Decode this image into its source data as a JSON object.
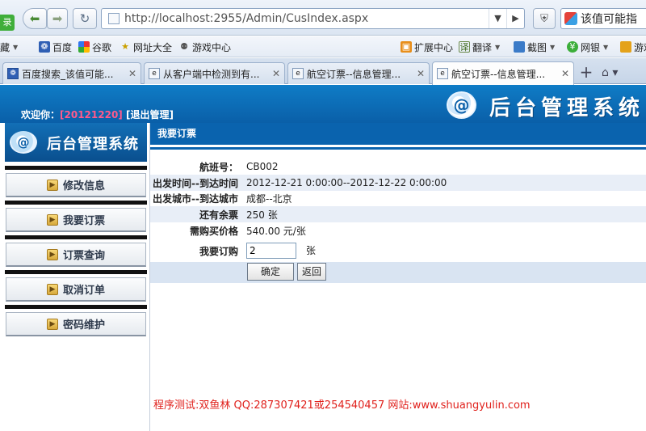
{
  "browser": {
    "url": "http://localhost:2955/Admin/CusIndex.aspx",
    "search_text": "该值可能指",
    "side_tab_text": "录",
    "bookmarks": [
      {
        "label": "藏"
      },
      {
        "label": "百度"
      },
      {
        "label": "谷歌"
      },
      {
        "label": "网址大全"
      },
      {
        "label": "游戏中心"
      },
      {
        "label": "扩展中心"
      },
      {
        "label": "翻译"
      },
      {
        "label": "截图"
      },
      {
        "label": "网银"
      },
      {
        "label": "游戏"
      }
    ],
    "tabs": [
      {
        "title": "百度搜索_该值可能..."
      },
      {
        "title": "从客户端中检测到有..."
      },
      {
        "title": "航空订票--信息管理..."
      },
      {
        "title": "航空订票--信息管理..."
      }
    ]
  },
  "header": {
    "welcome_prefix": "欢迎你：",
    "user_id": "[20121220]",
    "logout": "[退出管理]",
    "system_title": "后台管理系统"
  },
  "sidebar": {
    "logo_title": "后台管理系统",
    "items": [
      {
        "label": "修改信息"
      },
      {
        "label": "我要订票"
      },
      {
        "label": "订票查询"
      },
      {
        "label": "取消订单"
      },
      {
        "label": "密码维护"
      }
    ]
  },
  "main": {
    "section_title": "我要订票",
    "fields": [
      {
        "label": "航班号：",
        "value": "CB002"
      },
      {
        "label": "出发时间--到达时间",
        "value": "2012-12-21 0:00:00--2012-12-22 0:00:00"
      },
      {
        "label": "出发城市--到达城市",
        "value": "成都--北京"
      },
      {
        "label": "还有余票",
        "value": "250 张"
      },
      {
        "label": "需购买价格",
        "value": "540.00 元/张"
      }
    ],
    "order_label": "我要订购",
    "order_value": "2",
    "order_unit": "张",
    "confirm_label": "确定",
    "back_label": "返回"
  },
  "footer": {
    "note": "程序测试:双鱼林  QQ:287307421或254540457 网站:www.shuangyulin.com"
  }
}
